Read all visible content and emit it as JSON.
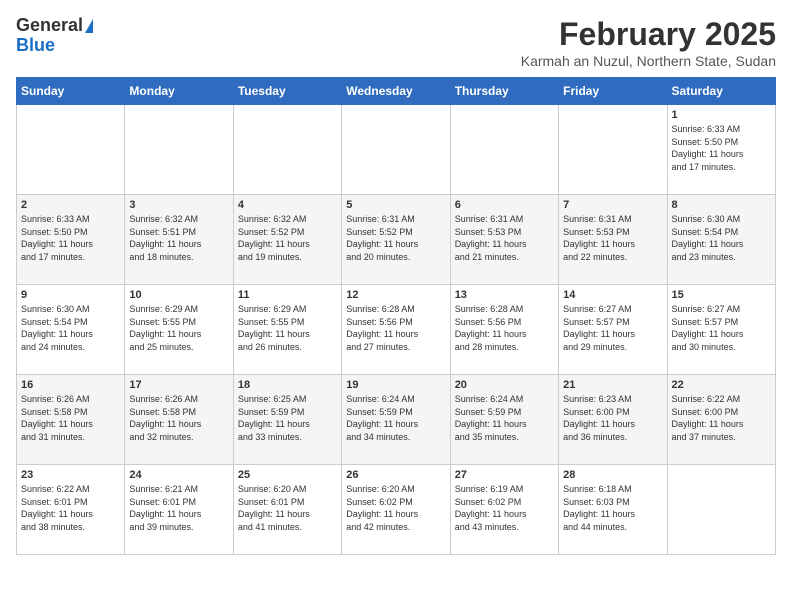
{
  "logo": {
    "general": "General",
    "blue": "Blue"
  },
  "header": {
    "month_year": "February 2025",
    "location": "Karmah an Nuzul, Northern State, Sudan"
  },
  "days_of_week": [
    "Sunday",
    "Monday",
    "Tuesday",
    "Wednesday",
    "Thursday",
    "Friday",
    "Saturday"
  ],
  "weeks": [
    {
      "days": [
        {
          "num": "",
          "info": ""
        },
        {
          "num": "",
          "info": ""
        },
        {
          "num": "",
          "info": ""
        },
        {
          "num": "",
          "info": ""
        },
        {
          "num": "",
          "info": ""
        },
        {
          "num": "",
          "info": ""
        },
        {
          "num": "1",
          "info": "Sunrise: 6:33 AM\nSunset: 5:50 PM\nDaylight: 11 hours\nand 17 minutes."
        }
      ]
    },
    {
      "days": [
        {
          "num": "2",
          "info": "Sunrise: 6:33 AM\nSunset: 5:50 PM\nDaylight: 11 hours\nand 17 minutes."
        },
        {
          "num": "3",
          "info": "Sunrise: 6:32 AM\nSunset: 5:51 PM\nDaylight: 11 hours\nand 18 minutes."
        },
        {
          "num": "4",
          "info": "Sunrise: 6:32 AM\nSunset: 5:52 PM\nDaylight: 11 hours\nand 19 minutes."
        },
        {
          "num": "5",
          "info": "Sunrise: 6:31 AM\nSunset: 5:52 PM\nDaylight: 11 hours\nand 20 minutes."
        },
        {
          "num": "6",
          "info": "Sunrise: 6:31 AM\nSunset: 5:53 PM\nDaylight: 11 hours\nand 21 minutes."
        },
        {
          "num": "7",
          "info": "Sunrise: 6:31 AM\nSunset: 5:53 PM\nDaylight: 11 hours\nand 22 minutes."
        },
        {
          "num": "8",
          "info": "Sunrise: 6:30 AM\nSunset: 5:54 PM\nDaylight: 11 hours\nand 23 minutes."
        }
      ]
    },
    {
      "days": [
        {
          "num": "9",
          "info": "Sunrise: 6:30 AM\nSunset: 5:54 PM\nDaylight: 11 hours\nand 24 minutes."
        },
        {
          "num": "10",
          "info": "Sunrise: 6:29 AM\nSunset: 5:55 PM\nDaylight: 11 hours\nand 25 minutes."
        },
        {
          "num": "11",
          "info": "Sunrise: 6:29 AM\nSunset: 5:55 PM\nDaylight: 11 hours\nand 26 minutes."
        },
        {
          "num": "12",
          "info": "Sunrise: 6:28 AM\nSunset: 5:56 PM\nDaylight: 11 hours\nand 27 minutes."
        },
        {
          "num": "13",
          "info": "Sunrise: 6:28 AM\nSunset: 5:56 PM\nDaylight: 11 hours\nand 28 minutes."
        },
        {
          "num": "14",
          "info": "Sunrise: 6:27 AM\nSunset: 5:57 PM\nDaylight: 11 hours\nand 29 minutes."
        },
        {
          "num": "15",
          "info": "Sunrise: 6:27 AM\nSunset: 5:57 PM\nDaylight: 11 hours\nand 30 minutes."
        }
      ]
    },
    {
      "days": [
        {
          "num": "16",
          "info": "Sunrise: 6:26 AM\nSunset: 5:58 PM\nDaylight: 11 hours\nand 31 minutes."
        },
        {
          "num": "17",
          "info": "Sunrise: 6:26 AM\nSunset: 5:58 PM\nDaylight: 11 hours\nand 32 minutes."
        },
        {
          "num": "18",
          "info": "Sunrise: 6:25 AM\nSunset: 5:59 PM\nDaylight: 11 hours\nand 33 minutes."
        },
        {
          "num": "19",
          "info": "Sunrise: 6:24 AM\nSunset: 5:59 PM\nDaylight: 11 hours\nand 34 minutes."
        },
        {
          "num": "20",
          "info": "Sunrise: 6:24 AM\nSunset: 5:59 PM\nDaylight: 11 hours\nand 35 minutes."
        },
        {
          "num": "21",
          "info": "Sunrise: 6:23 AM\nSunset: 6:00 PM\nDaylight: 11 hours\nand 36 minutes."
        },
        {
          "num": "22",
          "info": "Sunrise: 6:22 AM\nSunset: 6:00 PM\nDaylight: 11 hours\nand 37 minutes."
        }
      ]
    },
    {
      "days": [
        {
          "num": "23",
          "info": "Sunrise: 6:22 AM\nSunset: 6:01 PM\nDaylight: 11 hours\nand 38 minutes."
        },
        {
          "num": "24",
          "info": "Sunrise: 6:21 AM\nSunset: 6:01 PM\nDaylight: 11 hours\nand 39 minutes."
        },
        {
          "num": "25",
          "info": "Sunrise: 6:20 AM\nSunset: 6:01 PM\nDaylight: 11 hours\nand 41 minutes."
        },
        {
          "num": "26",
          "info": "Sunrise: 6:20 AM\nSunset: 6:02 PM\nDaylight: 11 hours\nand 42 minutes."
        },
        {
          "num": "27",
          "info": "Sunrise: 6:19 AM\nSunset: 6:02 PM\nDaylight: 11 hours\nand 43 minutes."
        },
        {
          "num": "28",
          "info": "Sunrise: 6:18 AM\nSunset: 6:03 PM\nDaylight: 11 hours\nand 44 minutes."
        },
        {
          "num": "",
          "info": ""
        }
      ]
    }
  ]
}
